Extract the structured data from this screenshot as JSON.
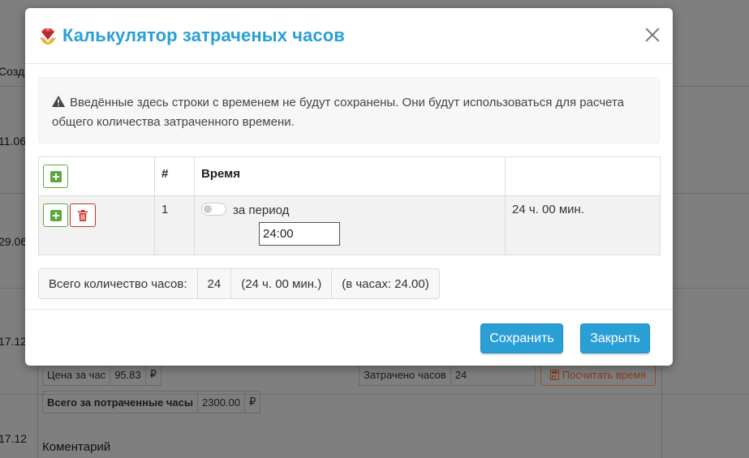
{
  "background": {
    "col_header": "Созд",
    "dates": [
      "11.06",
      "29.06",
      "17.12",
      "17.12"
    ],
    "price_label": "Цена за час",
    "price_value": "95.83",
    "price_currency": "₽",
    "total_label": "Всего за потраченные часы",
    "total_value": "2300.00",
    "total_currency": "₽",
    "spent_label": "Затрачено часов",
    "spent_value": "24",
    "calc_button": "Посчитать время",
    "comment_label": "Коментарий"
  },
  "modal": {
    "title": "Калькулятор затраченых часов",
    "alert_text": "Введённые здесь строки с временем не будут сохранены. Они будут использоваться для расчета общего количества затраченного времени.",
    "table": {
      "headers": [
        "",
        "#",
        "Время",
        ""
      ],
      "rows": [
        {
          "num": "1",
          "toggle_label": "за период",
          "time_value": "24:00",
          "result": "24 ч. 00 мин."
        }
      ]
    },
    "totals": {
      "label": "Всего количество часов:",
      "hours": "24",
      "formatted": "(24 ч. 00 мин.)",
      "in_hours": "(в часах: 24.00)"
    },
    "buttons": {
      "save": "Сохранить",
      "close": "Закрыть"
    },
    "colors": {
      "accent": "#2a9fd6",
      "add": "#5ca83d",
      "delete": "#c9302c"
    }
  }
}
